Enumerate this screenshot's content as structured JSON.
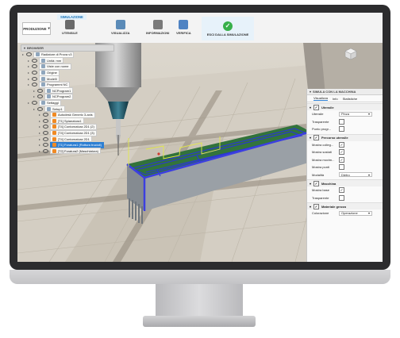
{
  "toolbar": {
    "workspace": "PRODUZIONE",
    "tab": "SIMULAZIONE",
    "buttons": [
      {
        "label": "UTENSILE",
        "color": "#6a6a6a"
      },
      {
        "label": "VISUALIZZA",
        "color": "#5b8bb8"
      },
      {
        "label": "INFORMAZIONI",
        "color": "#7a7a7a"
      },
      {
        "label": "VERIFICA",
        "color": "#4f83c3"
      }
    ],
    "exit_label": "ESCI DALLA SIMULAZIONE"
  },
  "browser": {
    "title": "BROWSER",
    "items": [
      {
        "text": "Radiatore di Prova v3",
        "level": 0
      },
      {
        "text": "Unità: mm",
        "level": 1
      },
      {
        "text": "Viste con nome",
        "level": 1
      },
      {
        "text": "Origine",
        "level": 1
      },
      {
        "text": "Modelli",
        "level": 1
      },
      {
        "text": "Programmi NC",
        "level": 1
      },
      {
        "text": "NCProgram1",
        "level": 2
      },
      {
        "text": "NCProgram2",
        "level": 2
      },
      {
        "text": "Settaggi",
        "level": 1
      },
      {
        "text": "Setup1",
        "level": 2
      },
      {
        "text": "Autodesk Generic 3-axis",
        "level": 3
      },
      {
        "text": "[T1] Spianatura1",
        "level": 3
      },
      {
        "text": "[T4] Contornatura 2D1 (2)",
        "level": 3
      },
      {
        "text": "[T4] Contornatura 2D1 (3)",
        "level": 3
      },
      {
        "text": "[T4] Contornatura 2D1",
        "level": 3
      },
      {
        "text": "[T1] Foratura1 (Rottura trucioli)",
        "level": 3,
        "selected": true
      },
      {
        "text": "[T2] Foratura2 (Maschiatura)",
        "level": 3
      }
    ]
  },
  "panel": {
    "title": "SIMULA CON LA MACCHINA",
    "tabs": [
      "Visualizza",
      "Info",
      "Statistiche"
    ],
    "sections": [
      {
        "title": "Utensile",
        "rows": [
          {
            "label": "Utensile",
            "type": "select",
            "value": "Pinza"
          },
          {
            "label": "Trasparente",
            "type": "check",
            "checked": false
          },
          {
            "label": "Punto progr...",
            "type": "check",
            "checked": false
          }
        ]
      },
      {
        "title": "Percorso utensile",
        "rows": [
          {
            "label": "Mostra colleg...",
            "type": "check",
            "checked": true
          },
          {
            "label": "Mostra sostati",
            "type": "check",
            "checked": true
          },
          {
            "label": "Mostra movim...",
            "type": "check",
            "checked": true
          },
          {
            "label": "Mostra punti",
            "type": "check",
            "checked": false
          },
          {
            "label": "Modalità",
            "type": "select",
            "value": "Dietro"
          }
        ]
      },
      {
        "title": "Macchina",
        "rows": [
          {
            "label": "Mostra base",
            "type": "check",
            "checked": true
          },
          {
            "label": "Trasparente",
            "type": "check",
            "checked": false
          }
        ]
      },
      {
        "title": "Materiale grezzo",
        "rows": [
          {
            "label": "Colorazione",
            "type": "select",
            "value": "Operazione"
          }
        ]
      }
    ]
  },
  "colors": {
    "accent": "#2d7fd3",
    "part_green": "#2f6b3a",
    "toolpath_blue": "#2a35d8",
    "toolpath_yellow": "#e3e84a",
    "exit_green": "#37b04a"
  }
}
